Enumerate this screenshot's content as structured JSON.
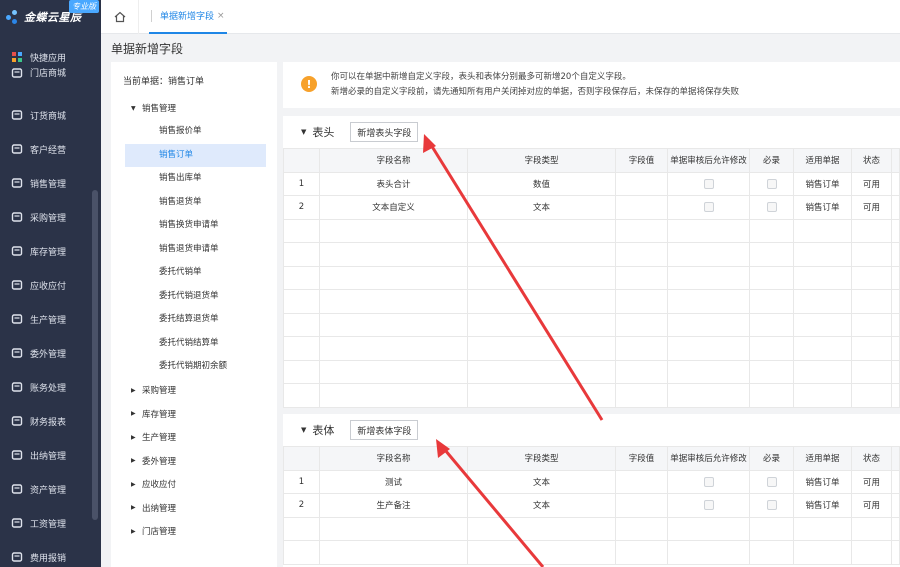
{
  "sidebar": {
    "logo_text": "金蝶云星辰",
    "logo_badge": "专业版",
    "items": [
      {
        "label": "快捷应用",
        "icon": "grid-icon"
      },
      {
        "label": "门店商城",
        "icon": "store-icon"
      },
      {
        "label": "订货商城",
        "icon": "bag-icon"
      },
      {
        "label": "客户经营",
        "icon": "user-icon"
      },
      {
        "label": "销售管理",
        "icon": "chart-icon"
      },
      {
        "label": "采购管理",
        "icon": "cart-icon"
      },
      {
        "label": "库存管理",
        "icon": "box-icon"
      },
      {
        "label": "应收应付",
        "icon": "coin-icon"
      },
      {
        "label": "生产管理",
        "icon": "factory-icon"
      },
      {
        "label": "委外管理",
        "icon": "outsource-icon"
      },
      {
        "label": "账务处理",
        "icon": "ledger-icon"
      },
      {
        "label": "财务报表",
        "icon": "report-icon"
      },
      {
        "label": "出纳管理",
        "icon": "cashier-icon"
      },
      {
        "label": "资产管理",
        "icon": "asset-icon"
      },
      {
        "label": "工资管理",
        "icon": "salary-icon"
      },
      {
        "label": "费用报销",
        "icon": "expense-icon"
      }
    ]
  },
  "topbar": {
    "tab_label": "单据新增字段",
    "tab_close": "×"
  },
  "page_title": "单据新增字段",
  "tree": {
    "current_label": "当前单据：销售订单",
    "expanded_group": "销售管理",
    "leaves": [
      "销售报价单",
      "销售订单",
      "销售出库单",
      "销售退货单",
      "销售换货申请单",
      "销售退货申请单",
      "委托代销单",
      "委托代销退货单",
      "委托结算退货单",
      "委托代销结算单",
      "委托代销期初余额"
    ],
    "active_leaf": "销售订单",
    "groups": [
      "采购管理",
      "库存管理",
      "生产管理",
      "委外管理",
      "应收应付",
      "出纳管理",
      "门店管理"
    ]
  },
  "notice": {
    "line1": "你可以在单据中新增自定义字段，表头和表体分别最多可新增20个自定义字段。",
    "line2": "新增必录的自定义字段前，请先通知所有用户关闭掉对应的单据，否则字段保存后，未保存的单据将保存失败"
  },
  "header_section": {
    "title": "表头",
    "add_button": "新增表头字段",
    "columns": [
      "",
      "字段名称",
      "字段类型",
      "字段值",
      "单据审核后允许修改",
      "必录",
      "适用单据",
      "状态"
    ],
    "rows": [
      {
        "no": "1",
        "name": "表头合计",
        "type": "数值",
        "value": "",
        "scope": "销售订单",
        "status": "可用"
      },
      {
        "no": "2",
        "name": "文本自定义",
        "type": "文本",
        "value": "",
        "scope": "销售订单",
        "status": "可用"
      }
    ]
  },
  "body_section": {
    "title": "表体",
    "add_button": "新增表体字段",
    "columns": [
      "",
      "字段名称",
      "字段类型",
      "字段值",
      "单据审核后允许修改",
      "必录",
      "适用单据",
      "状态"
    ],
    "rows": [
      {
        "no": "1",
        "name": "测试",
        "type": "文本",
        "value": "",
        "scope": "销售订单",
        "status": "可用"
      },
      {
        "no": "2",
        "name": "生产备注",
        "type": "文本",
        "value": "",
        "scope": "销售订单",
        "status": "可用"
      }
    ]
  },
  "colors": {
    "sidebar_bg": "#2b3348",
    "accent": "#1f86e6",
    "warning": "#f7a12b",
    "annotation_arrow": "#e8393b"
  }
}
